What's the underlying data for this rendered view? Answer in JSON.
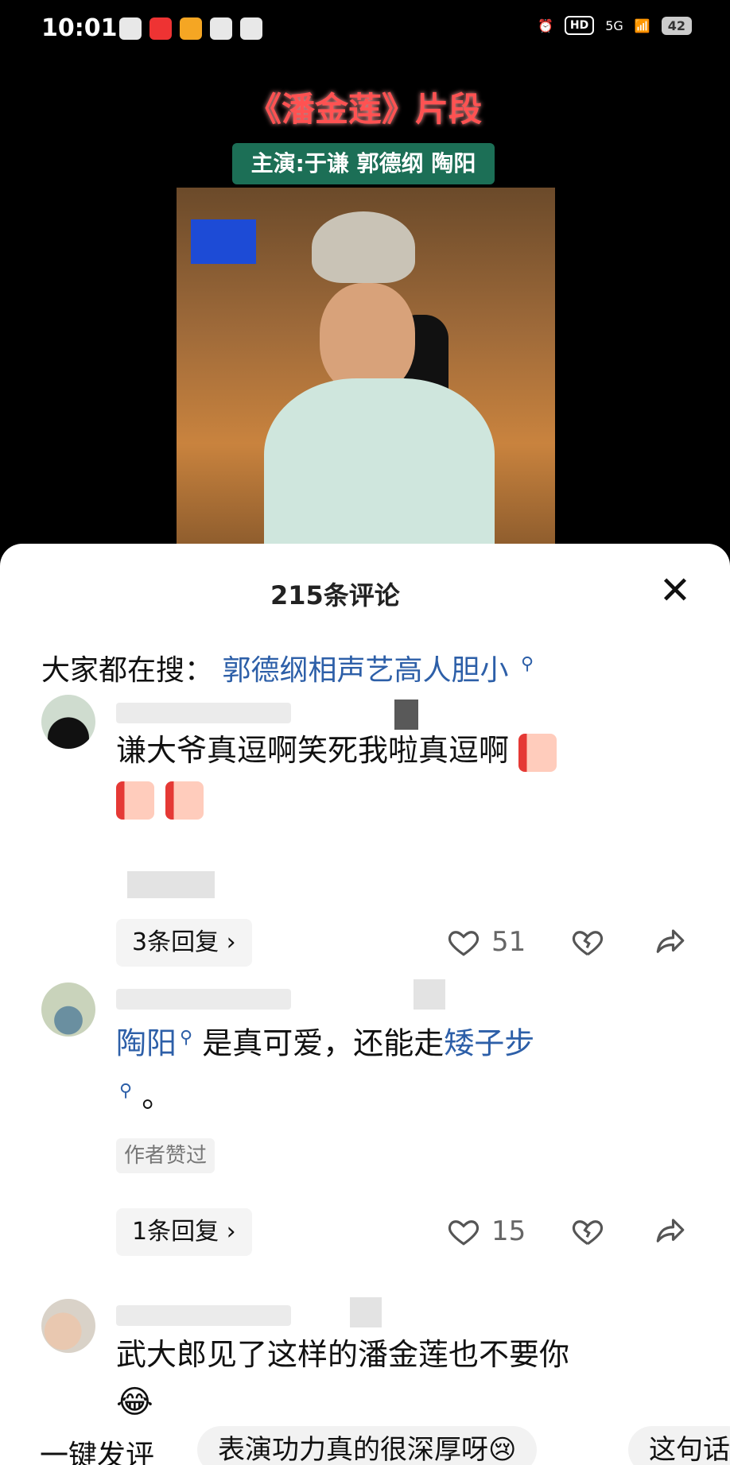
{
  "status_bar": {
    "time": "10:01",
    "hd": "HD",
    "net": "5G",
    "battery": "42"
  },
  "video": {
    "title": "《潘金莲》片段",
    "cast": "主演:于谦 郭德纲 陶阳"
  },
  "comments_sheet": {
    "title": "215条评论",
    "trending_label": "大家都在搜：",
    "trending_query": "郭德纲相声艺高人胆小"
  },
  "comments": [
    {
      "text_line1": "谦大爷真逗啊笑死我啦真逗啊",
      "reply_label": "3条回复 ›",
      "likes": "51"
    },
    {
      "link1": "陶阳",
      "text_mid": "是真可爱，还能走",
      "link2": "矮子步",
      "text_end": "。",
      "author_badge": "作者赞过",
      "reply_label": "1条回复 ›",
      "likes": "15"
    },
    {
      "text_line1": "武大郎见了这样的潘金莲也不要你",
      "emoji": "😂"
    }
  ],
  "bottom_bar": {
    "label": "一键发评",
    "chip1": "表演功力真的很深厚呀😢",
    "chip2": "这句话"
  }
}
